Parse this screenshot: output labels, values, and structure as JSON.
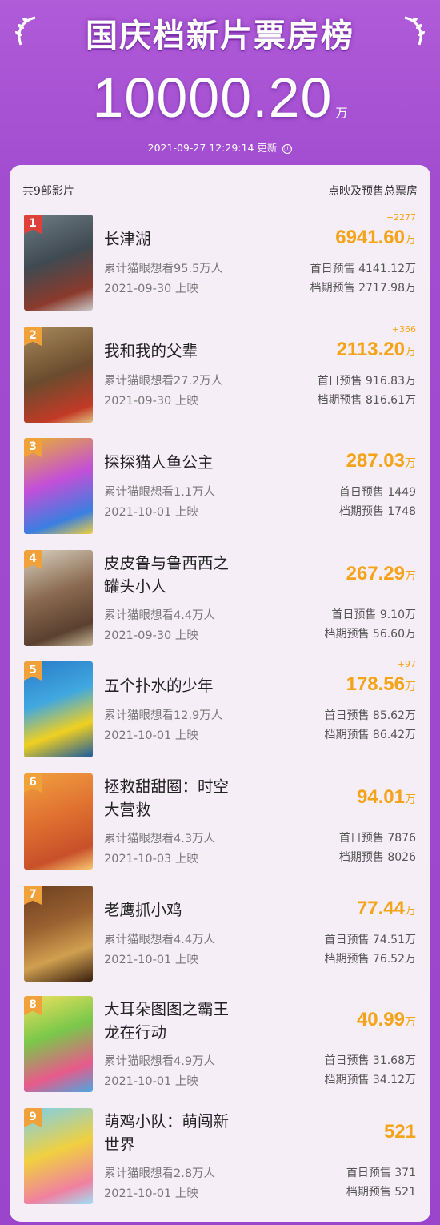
{
  "header": {
    "title": "国庆档新片票房榜",
    "total": "10000.20",
    "total_unit": "万",
    "update_time": "2021-09-27 12:29:14 更新",
    "info_icon": "ⓘ"
  },
  "panel": {
    "count_label": "共9部影片",
    "right_label": "点映及预售总票房"
  },
  "colors": {
    "accent": "#f5a318",
    "background": "#a24cd0",
    "panel": "#f6eef7",
    "rank_top": "#e0403a",
    "rank_other": "#f0a13a"
  },
  "movies": [
    {
      "rank": "1",
      "name": "长津湖",
      "gross": "6941.60",
      "unit": "万",
      "delta": "+2277",
      "want": "累计猫眼想看95.5万人",
      "date": "2021-09-30 上映",
      "first": "首日预售 4141.12万",
      "period": "档期预售 2717.98万"
    },
    {
      "rank": "2",
      "name": "我和我的父辈",
      "gross": "2113.20",
      "unit": "万",
      "delta": "+366",
      "want": "累计猫眼想看27.2万人",
      "date": "2021-09-30 上映",
      "first": "首日预售 916.83万",
      "period": "档期预售 816.61万"
    },
    {
      "rank": "3",
      "name": "探探猫人鱼公主",
      "gross": "287.03",
      "unit": "万",
      "delta": "",
      "want": "累计猫眼想看1.1万人",
      "date": "2021-10-01 上映",
      "first": "首日预售 1449",
      "period": "档期预售 1748"
    },
    {
      "rank": "4",
      "name": "皮皮鲁与鲁西西之罐头小人",
      "name_l1": "皮皮鲁与鲁西西之",
      "name_l2": "罐头小人",
      "gross": "267.29",
      "unit": "万",
      "delta": "",
      "want": "累计猫眼想看4.4万人",
      "date": "2021-09-30 上映",
      "first": "首日预售 9.10万",
      "period": "档期预售 56.60万"
    },
    {
      "rank": "5",
      "name": "五个扑水的少年",
      "gross": "178.56",
      "unit": "万",
      "delta": "+97",
      "want": "累计猫眼想看12.9万人",
      "date": "2021-10-01 上映",
      "first": "首日预售 85.62万",
      "period": "档期预售 86.42万"
    },
    {
      "rank": "6",
      "name": "拯救甜甜圈：时空大营救",
      "name_l1": "拯救甜甜圈：时空",
      "name_l2": "大营救",
      "gross": "94.01",
      "unit": "万",
      "delta": "",
      "want": "累计猫眼想看4.3万人",
      "date": "2021-10-03 上映",
      "first": "首日预售 7876",
      "period": "档期预售 8026"
    },
    {
      "rank": "7",
      "name": "老鹰抓小鸡",
      "gross": "77.44",
      "unit": "万",
      "delta": "",
      "want": "累计猫眼想看4.4万人",
      "date": "2021-10-01 上映",
      "first": "首日预售 74.51万",
      "period": "档期预售 76.52万"
    },
    {
      "rank": "8",
      "name": "大耳朵图图之霸王龙在行动",
      "name_l1": "大耳朵图图之霸王",
      "name_l2": "龙在行动",
      "gross": "40.99",
      "unit": "万",
      "delta": "",
      "want": "累计猫眼想看4.9万人",
      "date": "2021-10-01 上映",
      "first": "首日预售 31.68万",
      "period": "档期预售 34.12万"
    },
    {
      "rank": "9",
      "name": "萌鸡小队：萌闯新世界",
      "name_l1": "萌鸡小队：萌闯新",
      "name_l2": "世界",
      "gross": "521",
      "unit": "",
      "delta": "",
      "want": "累计猫眼想看2.8万人",
      "date": "2021-10-01 上映",
      "first": "首日预售 371",
      "period": "档期预售 521"
    }
  ]
}
